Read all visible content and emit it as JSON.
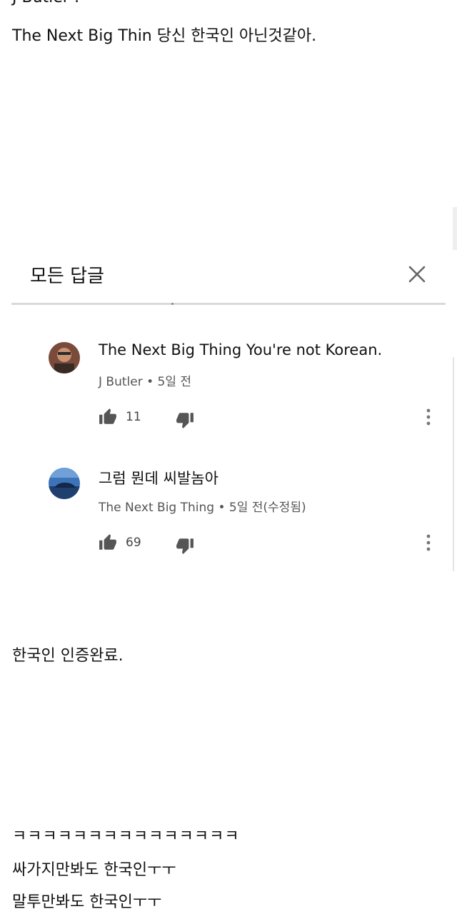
{
  "post": {
    "cut_line": "J Butler :",
    "line1": "The Next Big Thin 당신 한국인 아닌것같아.",
    "verified": "한국인 인증완료.",
    "laugh": "ㅋㅋㅋㅋㅋㅋㅋㅋㅋㅋㅋㅋㅋㅋㅋ",
    "line_a": "싸가지만봐도 한국인ㅜㅜ",
    "line_b": "말투만봐도 한국인ㅜㅜ"
  },
  "screenshot": {
    "title": "모든 답글",
    "close_icon": "close-icon",
    "comments": [
      {
        "text": "The Next Big Thing You're not Korean.",
        "author": "J Butler",
        "separator": "•",
        "time": "5일 전",
        "likes": "11",
        "avatar_icon": "user-avatar-photo"
      },
      {
        "text": "그럼 뭔데 씨발놈아",
        "author": "The Next Big Thing",
        "separator": "•",
        "time": "5일 전(수정됨)",
        "likes": "69",
        "avatar_icon": "user-avatar-car"
      }
    ]
  },
  "icons": {
    "like": "thumbs-up-icon",
    "dislike": "thumbs-down-icon",
    "more": "more-vert-icon"
  },
  "colors": {
    "text": "#111111",
    "meta": "#555555",
    "divider": "#d9d9d9",
    "background": "#ffffff"
  }
}
